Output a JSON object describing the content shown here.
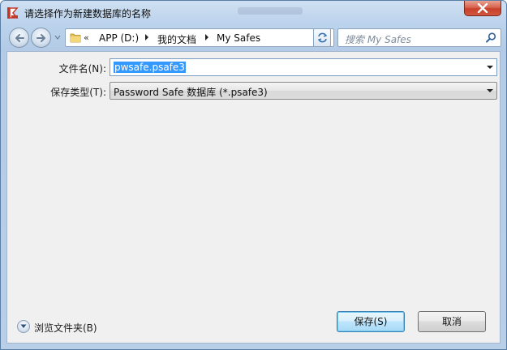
{
  "window": {
    "title": "请选择作为新建数据库的名称",
    "accent_color": "#3399ff",
    "close_color": "#c8402a"
  },
  "navigation": {
    "back_icon": "back-arrow-icon",
    "forward_icon": "forward-arrow-icon",
    "breadcrumb_overflow": "«",
    "breadcrumbs": [
      "APP (D:)",
      "我的文档",
      "My Safes"
    ],
    "search_placeholder": "搜索 My Safes"
  },
  "form": {
    "filename_label": "文件名(N):",
    "filename_value": "pwsafe.psafe3",
    "filetype_label": "保存类型(T):",
    "filetype_value": "Password Safe 数据库 (*.psafe3)"
  },
  "footer": {
    "browse_folders_label": "浏览文件夹(B)",
    "save_label": "保存(S)",
    "cancel_label": "取消"
  }
}
